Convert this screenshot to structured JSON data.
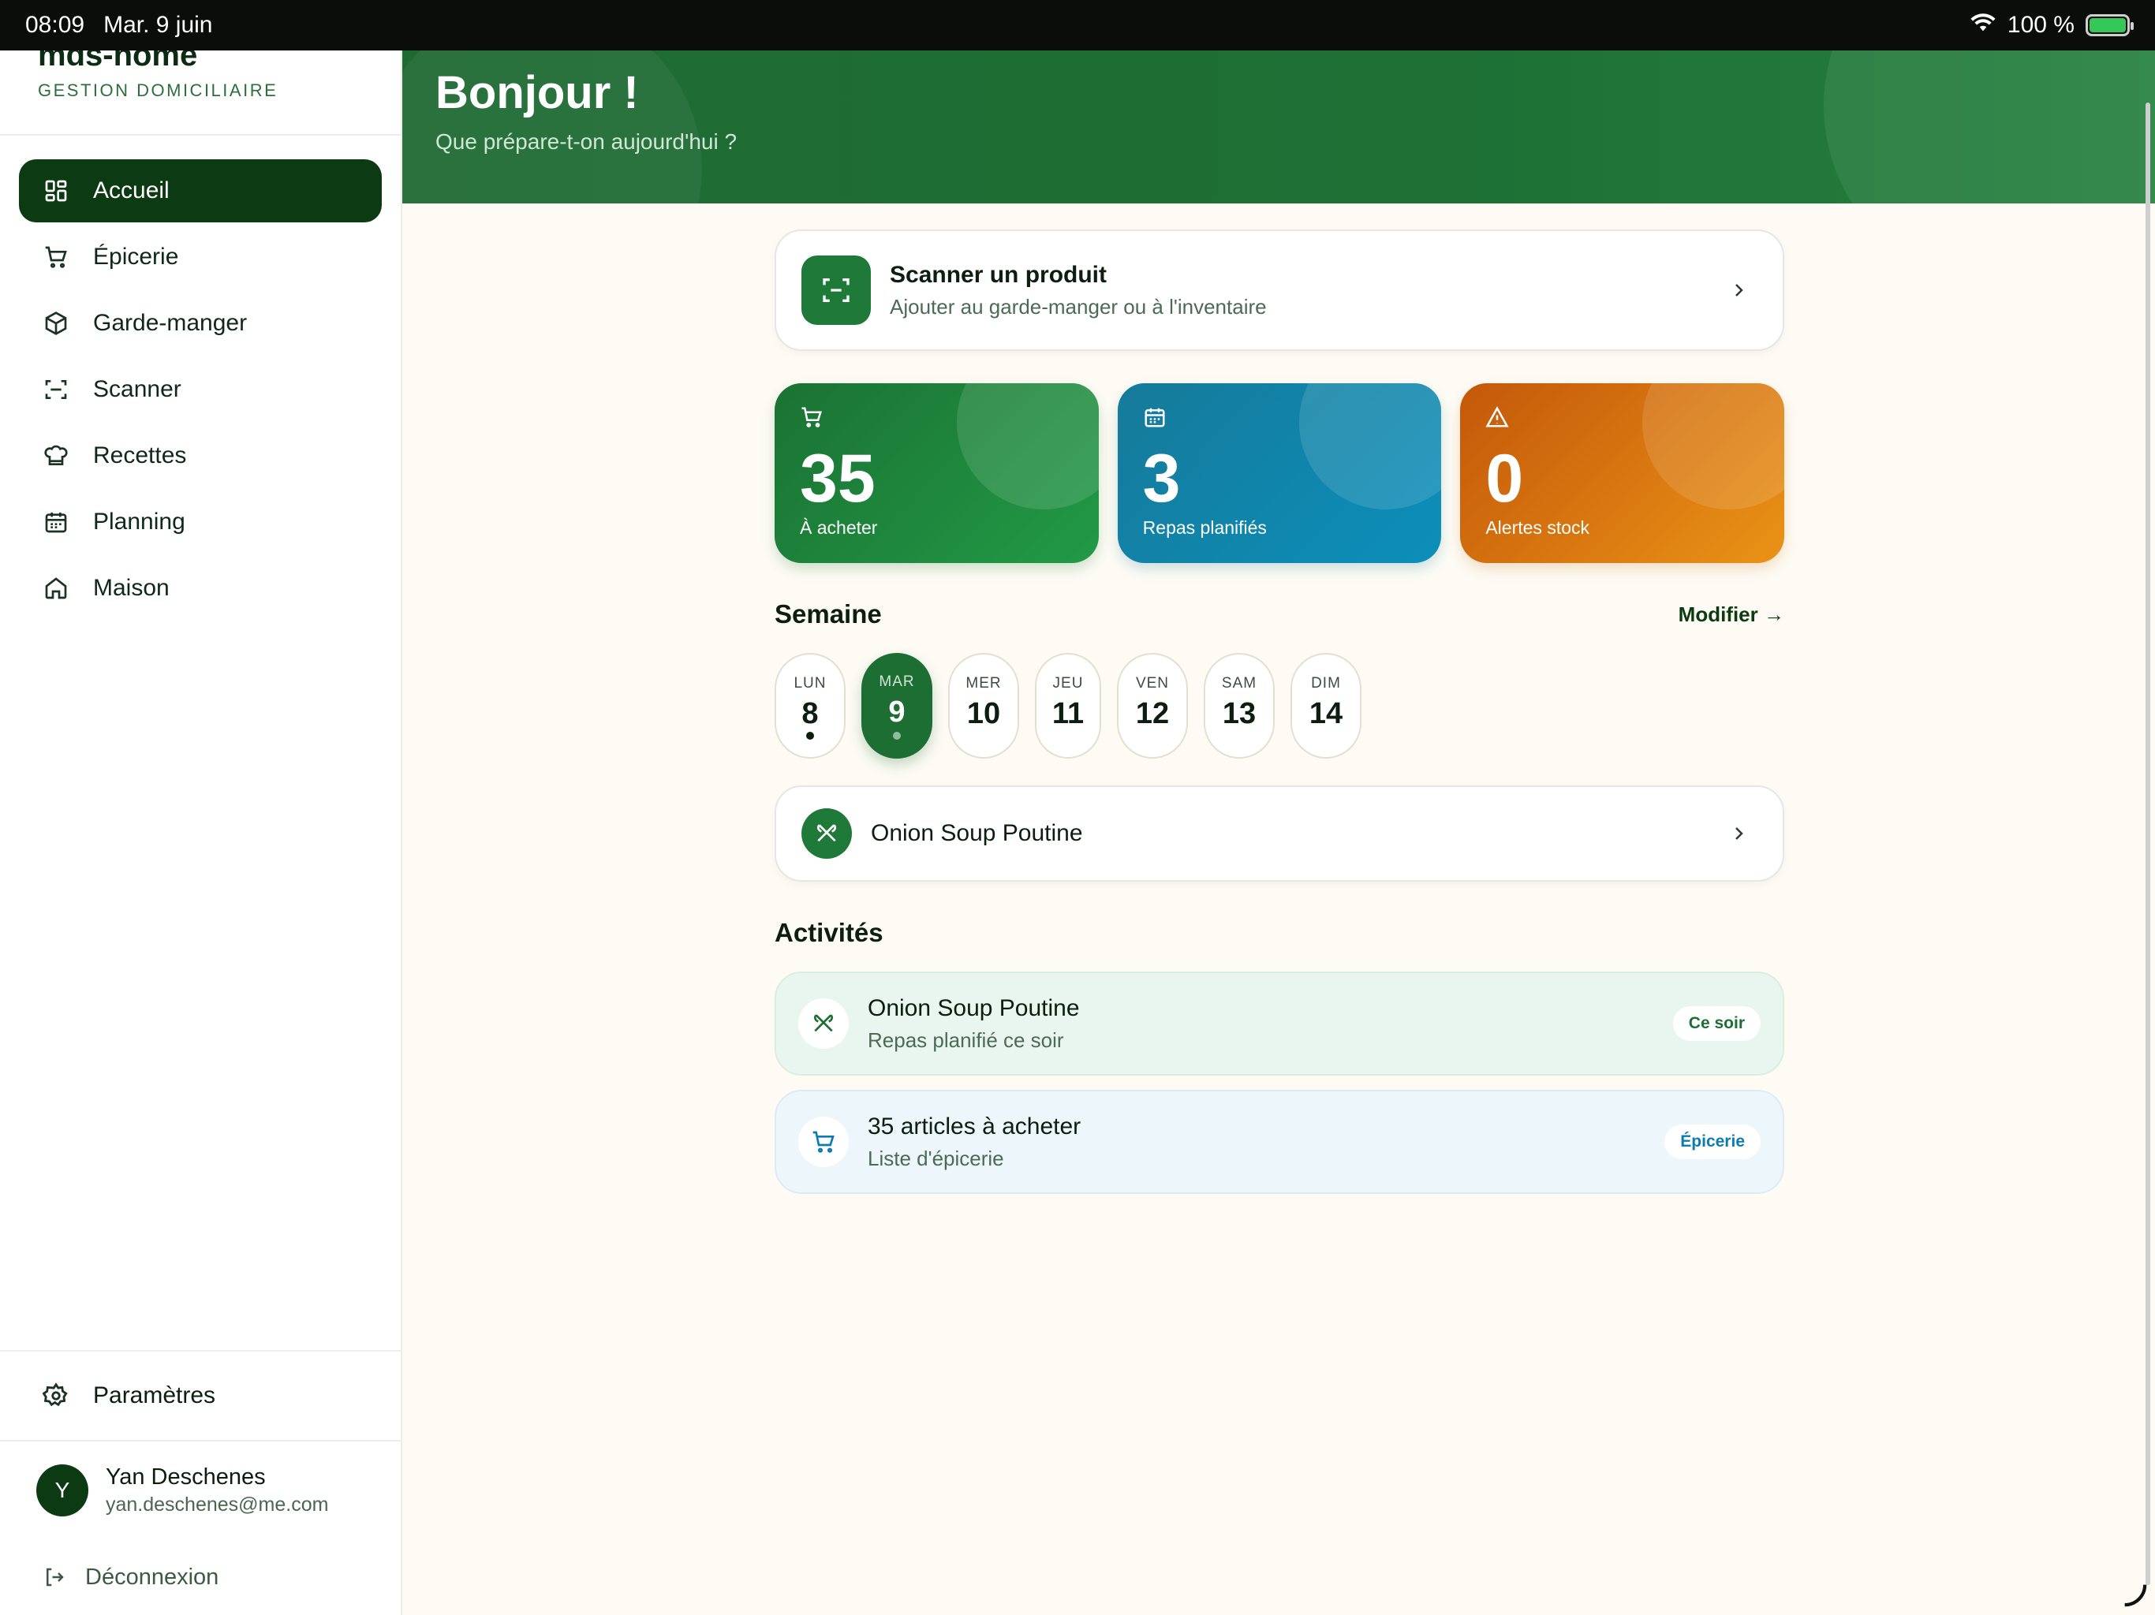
{
  "status_bar": {
    "time": "08:09",
    "date": "Mar. 9 juin",
    "battery": "100 %"
  },
  "brand": {
    "name": "mds-home",
    "subtitle": "GESTION DOMICILIAIRE"
  },
  "nav": {
    "items": [
      {
        "label": "Accueil",
        "icon": "dashboard-icon",
        "active": true
      },
      {
        "label": "Épicerie",
        "icon": "cart-icon"
      },
      {
        "label": "Garde-manger",
        "icon": "box-icon"
      },
      {
        "label": "Scanner",
        "icon": "scan-icon"
      },
      {
        "label": "Recettes",
        "icon": "chef-hat-icon"
      },
      {
        "label": "Planning",
        "icon": "calendar-icon"
      },
      {
        "label": "Maison",
        "icon": "home-icon"
      }
    ],
    "settings": "Paramètres",
    "logout": "Déconnexion"
  },
  "user": {
    "initial": "Y",
    "name": "Yan Deschenes",
    "email": "yan.deschenes@me.com"
  },
  "header": {
    "title": "Bonjour !",
    "subtitle": "Que prépare-t-on aujourd'hui ?"
  },
  "scan_card": {
    "title": "Scanner un produit",
    "subtitle": "Ajouter au garde-manger ou à l'inventaire"
  },
  "stats": [
    {
      "value": "35",
      "label": "À acheter",
      "icon": "cart-icon",
      "color": "#1f8a3d"
    },
    {
      "value": "3",
      "label": "Repas planifiés",
      "icon": "calendar-icon",
      "color": "#0f87b0"
    },
    {
      "value": "0",
      "label": "Alertes stock",
      "icon": "warning-icon",
      "color": "#de7d12"
    }
  ],
  "week": {
    "title": "Semaine",
    "modify": "Modifier →",
    "days": [
      {
        "name": "LUN",
        "num": "8",
        "dot": true
      },
      {
        "name": "MAR",
        "num": "9",
        "selected": true,
        "dot": true
      },
      {
        "name": "MER",
        "num": "10"
      },
      {
        "name": "JEU",
        "num": "11"
      },
      {
        "name": "VEN",
        "num": "12"
      },
      {
        "name": "SAM",
        "num": "13"
      },
      {
        "name": "DIM",
        "num": "14"
      }
    ]
  },
  "meal": {
    "title": "Onion Soup Poutine"
  },
  "activities": {
    "title": "Activités",
    "items": [
      {
        "title": "Onion Soup Poutine",
        "subtitle": "Repas planifié ce soir",
        "badge": "Ce soir",
        "icon": "utensils-icon"
      },
      {
        "title": "35 articles à acheter",
        "subtitle": "Liste d'épicerie",
        "badge": "Épicerie",
        "icon": "cart-icon"
      }
    ]
  }
}
